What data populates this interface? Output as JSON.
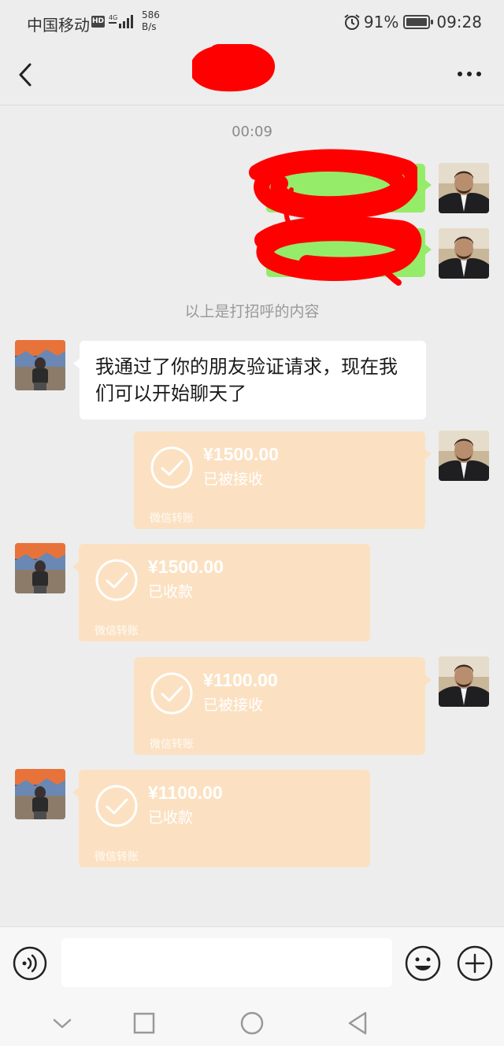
{
  "status_bar": {
    "carrier": "中国移动",
    "hd_badge": "HD",
    "network_type": "4G",
    "speed_value": "586",
    "speed_unit": "B/s",
    "battery_percent": "91%",
    "time": "09:28"
  },
  "header": {
    "title": "",
    "back_icon": "chevron-left-icon",
    "more_icon": "more-dots-icon"
  },
  "chat": {
    "timestamp": "00:09",
    "system_notice": "以上是打招呼的内容",
    "friend_message": "我通过了你的朋友验证请求，现在我们可以开始聊天了",
    "transfers": [
      {
        "side": "right",
        "amount": "¥1500.00",
        "status": "已被接收",
        "footer": "微信转账"
      },
      {
        "side": "left",
        "amount": "¥1500.00",
        "status": "已收款",
        "footer": "微信转账"
      },
      {
        "side": "right",
        "amount": "¥1100.00",
        "status": "已被接收",
        "footer": "微信转账"
      },
      {
        "side": "left",
        "amount": "¥1100.00",
        "status": "已收款",
        "footer": "微信转账"
      }
    ]
  },
  "input_bar": {
    "placeholder": "",
    "voice_icon": "voice-icon",
    "emoji_icon": "emoji-icon",
    "plus_icon": "plus-icon"
  },
  "colors": {
    "background": "#ededed",
    "self_bubble": "#95ec69",
    "transfer_bubble": "#fbe1c2",
    "redaction": "#ff0000"
  }
}
